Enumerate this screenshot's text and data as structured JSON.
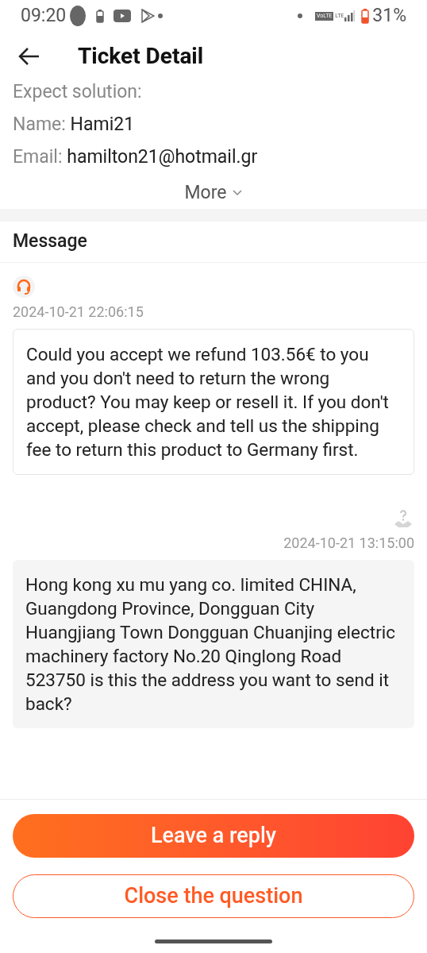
{
  "status_bar": {
    "time": "09:20",
    "network_badge": "VoLTE",
    "network_type": "LTE",
    "battery": "31%"
  },
  "header": {
    "title": "Ticket Detail"
  },
  "details": [
    {
      "label": "Expect solution:"
    },
    {
      "label": "Name:",
      "value": "Hami21"
    },
    {
      "label": "Email:",
      "value": "hamilton21@hotmail.gr"
    }
  ],
  "more": "More",
  "messages_section": {
    "title": "Message",
    "messages": [
      {
        "kind": "agent",
        "time": "2024-10-21 22:06:15",
        "text": "Could you accept we refund 103.56€ to you and you don't need to return the wrong product? You may keep or resell it. If you don't accept, please check and tell us the shipping fee to return this product to Germany first."
      },
      {
        "kind": "user",
        "time": "2024-10-21 13:15:00",
        "text": "Hong kong xu mu yang co. limited CHINA, Guangdong Province, Dongguan City Huangjiang Town Dongguan Chuanjing electric machinery factory No.20 Qinglong Road 523750 is this the address you want to send it back?"
      }
    ]
  },
  "buttons": {
    "primary": "Leave a reply",
    "secondary": "Close the question"
  }
}
